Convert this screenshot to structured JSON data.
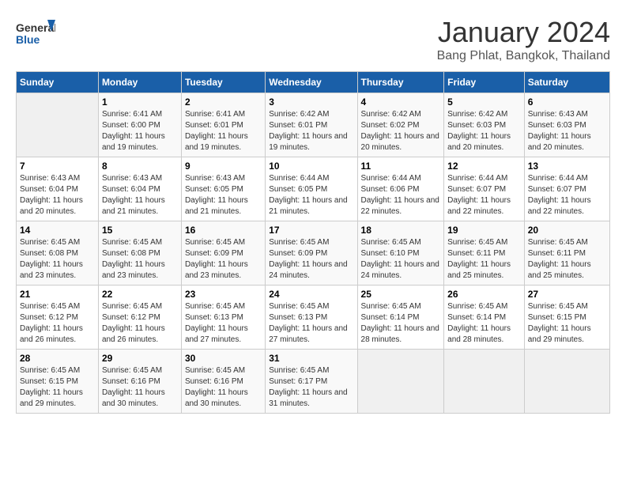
{
  "header": {
    "logo_general": "General",
    "logo_blue": "Blue",
    "title": "January 2024",
    "subtitle": "Bang Phlat, Bangkok, Thailand"
  },
  "weekdays": [
    "Sunday",
    "Monday",
    "Tuesday",
    "Wednesday",
    "Thursday",
    "Friday",
    "Saturday"
  ],
  "weeks": [
    [
      {
        "day": "",
        "empty": true
      },
      {
        "day": "1",
        "sunrise": "6:41 AM",
        "sunset": "6:00 PM",
        "daylight": "11 hours and 19 minutes."
      },
      {
        "day": "2",
        "sunrise": "6:41 AM",
        "sunset": "6:01 PM",
        "daylight": "11 hours and 19 minutes."
      },
      {
        "day": "3",
        "sunrise": "6:42 AM",
        "sunset": "6:01 PM",
        "daylight": "11 hours and 19 minutes."
      },
      {
        "day": "4",
        "sunrise": "6:42 AM",
        "sunset": "6:02 PM",
        "daylight": "11 hours and 20 minutes."
      },
      {
        "day": "5",
        "sunrise": "6:42 AM",
        "sunset": "6:03 PM",
        "daylight": "11 hours and 20 minutes."
      },
      {
        "day": "6",
        "sunrise": "6:43 AM",
        "sunset": "6:03 PM",
        "daylight": "11 hours and 20 minutes."
      }
    ],
    [
      {
        "day": "7",
        "sunrise": "6:43 AM",
        "sunset": "6:04 PM",
        "daylight": "11 hours and 20 minutes."
      },
      {
        "day": "8",
        "sunrise": "6:43 AM",
        "sunset": "6:04 PM",
        "daylight": "11 hours and 21 minutes."
      },
      {
        "day": "9",
        "sunrise": "6:43 AM",
        "sunset": "6:05 PM",
        "daylight": "11 hours and 21 minutes."
      },
      {
        "day": "10",
        "sunrise": "6:44 AM",
        "sunset": "6:05 PM",
        "daylight": "11 hours and 21 minutes."
      },
      {
        "day": "11",
        "sunrise": "6:44 AM",
        "sunset": "6:06 PM",
        "daylight": "11 hours and 22 minutes."
      },
      {
        "day": "12",
        "sunrise": "6:44 AM",
        "sunset": "6:07 PM",
        "daylight": "11 hours and 22 minutes."
      },
      {
        "day": "13",
        "sunrise": "6:44 AM",
        "sunset": "6:07 PM",
        "daylight": "11 hours and 22 minutes."
      }
    ],
    [
      {
        "day": "14",
        "sunrise": "6:45 AM",
        "sunset": "6:08 PM",
        "daylight": "11 hours and 23 minutes."
      },
      {
        "day": "15",
        "sunrise": "6:45 AM",
        "sunset": "6:08 PM",
        "daylight": "11 hours and 23 minutes."
      },
      {
        "day": "16",
        "sunrise": "6:45 AM",
        "sunset": "6:09 PM",
        "daylight": "11 hours and 23 minutes."
      },
      {
        "day": "17",
        "sunrise": "6:45 AM",
        "sunset": "6:09 PM",
        "daylight": "11 hours and 24 minutes."
      },
      {
        "day": "18",
        "sunrise": "6:45 AM",
        "sunset": "6:10 PM",
        "daylight": "11 hours and 24 minutes."
      },
      {
        "day": "19",
        "sunrise": "6:45 AM",
        "sunset": "6:11 PM",
        "daylight": "11 hours and 25 minutes."
      },
      {
        "day": "20",
        "sunrise": "6:45 AM",
        "sunset": "6:11 PM",
        "daylight": "11 hours and 25 minutes."
      }
    ],
    [
      {
        "day": "21",
        "sunrise": "6:45 AM",
        "sunset": "6:12 PM",
        "daylight": "11 hours and 26 minutes."
      },
      {
        "day": "22",
        "sunrise": "6:45 AM",
        "sunset": "6:12 PM",
        "daylight": "11 hours and 26 minutes."
      },
      {
        "day": "23",
        "sunrise": "6:45 AM",
        "sunset": "6:13 PM",
        "daylight": "11 hours and 27 minutes."
      },
      {
        "day": "24",
        "sunrise": "6:45 AM",
        "sunset": "6:13 PM",
        "daylight": "11 hours and 27 minutes."
      },
      {
        "day": "25",
        "sunrise": "6:45 AM",
        "sunset": "6:14 PM",
        "daylight": "11 hours and 28 minutes."
      },
      {
        "day": "26",
        "sunrise": "6:45 AM",
        "sunset": "6:14 PM",
        "daylight": "11 hours and 28 minutes."
      },
      {
        "day": "27",
        "sunrise": "6:45 AM",
        "sunset": "6:15 PM",
        "daylight": "11 hours and 29 minutes."
      }
    ],
    [
      {
        "day": "28",
        "sunrise": "6:45 AM",
        "sunset": "6:15 PM",
        "daylight": "11 hours and 29 minutes."
      },
      {
        "day": "29",
        "sunrise": "6:45 AM",
        "sunset": "6:16 PM",
        "daylight": "11 hours and 30 minutes."
      },
      {
        "day": "30",
        "sunrise": "6:45 AM",
        "sunset": "6:16 PM",
        "daylight": "11 hours and 30 minutes."
      },
      {
        "day": "31",
        "sunrise": "6:45 AM",
        "sunset": "6:17 PM",
        "daylight": "11 hours and 31 minutes."
      },
      {
        "day": "",
        "empty": true
      },
      {
        "day": "",
        "empty": true
      },
      {
        "day": "",
        "empty": true
      }
    ]
  ]
}
